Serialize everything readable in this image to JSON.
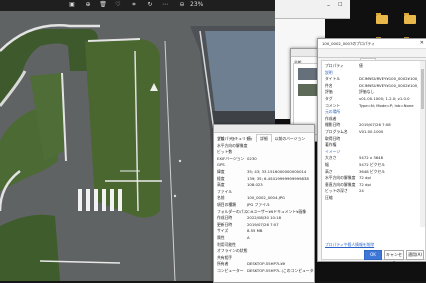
{
  "viewer": {
    "zoom": "23%",
    "toolbar_icons": [
      "image-icon",
      "zoom-in-icon",
      "delete-icon",
      "heart-icon",
      "crop-icon",
      "rotate-icon",
      "more-icon"
    ]
  },
  "desktop": {
    "folders": [
      "folder-icon",
      "folder-icon",
      "folder-icon",
      "folder-icon"
    ]
  },
  "win_back": {
    "title": "",
    "tabs": [
      "全般",
      "セキュリティ",
      "詳細",
      "以前のバージョン"
    ],
    "rows": [
      {
        "label": "プロパティ",
        "value": "値"
      },
      {
        "label": "水平方向の解像度",
        "value": ""
      },
      {
        "label": "ビット数",
        "value": ""
      },
      {
        "label": "EXIFバージョン",
        "value": "0230"
      },
      {
        "label": "GPS",
        "value": ""
      },
      {
        "label": "緯度",
        "value": "35; 43; 33.1516000000000014"
      },
      {
        "label": "経度",
        "value": "139; 35; 6.45419999999999838"
      },
      {
        "label": "高度",
        "value": "108.023"
      },
      {
        "label": "ファイル",
        "value": ""
      },
      {
        "label": "名前",
        "value": "100_0002_0004.JPG"
      },
      {
        "label": "項目の種類",
        "value": "JPG ファイル"
      },
      {
        "label": "フォルダーのパス",
        "value": "C:¥ユーザー¥¥ドキュメント¥画像"
      },
      {
        "label": "作成日時",
        "value": "2022/08/30 10:18"
      },
      {
        "label": "更新日時",
        "value": "2019/07/26 7:07"
      },
      {
        "label": "サイズ",
        "value": "8.55 MB"
      },
      {
        "label": "属性",
        "value": "A"
      },
      {
        "label": "利用可能性",
        "value": ""
      },
      {
        "label": "オフラインの状態",
        "value": ""
      },
      {
        "label": "共有相手",
        "value": ""
      },
      {
        "label": "所有者",
        "value": "DESKTOP-55HP7L¥¥"
      },
      {
        "label": "コンピューター",
        "value": "DESKTOP-55HP7L (このコンピューター)"
      }
    ]
  },
  "win_front": {
    "title": "100_0002_0007のプロパティ",
    "close_label": "✕",
    "tabs": [
      "全般",
      "セキュリティ",
      "詳細",
      "以前のバージョン"
    ],
    "rows": [
      {
        "label": "プロパティ",
        "value": "値",
        "section": false
      },
      {
        "label": "説明",
        "value": "",
        "section": true
      },
      {
        "label": "タイトル",
        "value": "DCIM¥SURVEY¥100_0002¥100_0002_0007",
        "section": false
      },
      {
        "label": "件名",
        "value": "DCIM¥SURVEY¥100_0002¥100_0002_0007",
        "section": false
      },
      {
        "label": "評価",
        "value": "評価なし",
        "section": false
      },
      {
        "label": "タグ",
        "value": "v01.00.1000; 1.2.0; v1.0.0",
        "section": false
      },
      {
        "label": "コメント",
        "value": "Type=N; Mode=P; Inb=None",
        "section": false
      },
      {
        "label": "元の場所",
        "value": "",
        "section": true
      },
      {
        "label": "作成者",
        "value": "",
        "section": false
      },
      {
        "label": "撮影日時",
        "value": "2019/07/26 7:08",
        "section": false
      },
      {
        "label": "プログラム名",
        "value": "V01.00.1000",
        "section": false
      },
      {
        "label": "取得日時",
        "value": "",
        "section": false
      },
      {
        "label": "著作権",
        "value": "",
        "section": false
      },
      {
        "label": "イメージ",
        "value": "",
        "section": true
      },
      {
        "label": "大きさ",
        "value": "5472 x 3648",
        "section": false
      },
      {
        "label": "幅",
        "value": "5472 ピクセル",
        "section": false
      },
      {
        "label": "高さ",
        "value": "3648 ピクセル",
        "section": false
      },
      {
        "label": "水平方向の解像度",
        "value": "72 dpi",
        "section": false
      },
      {
        "label": "垂直方向の解像度",
        "value": "72 dpi",
        "section": false
      },
      {
        "label": "ビットの深さ",
        "value": "24",
        "section": false
      },
      {
        "label": "圧縮",
        "value": "",
        "section": false
      }
    ],
    "link_label": "プロパティや個人情報を削除",
    "ok_label": "OK",
    "cancel_label": "キャンセル",
    "apply_label": "適用(A)"
  },
  "win_mid": {
    "tabs": [
      "全般",
      "セキュリティ",
      "詳細"
    ],
    "rows": [
      {
        "label": "プロパティ",
        "value": "値"
      },
      {
        "label": "説明",
        "value": ""
      },
      {
        "label": "タイトル",
        "value": "DCIM¥SURVEY¥100_0002"
      },
      {
        "label": "件名",
        "value": "DCIM¥SURVEY¥100_0002"
      },
      {
        "label": "評価",
        "value": "評価なし"
      },
      {
        "label": "タグ",
        "value": "v01.00.1000; 1.2.0"
      },
      {
        "label": "コメント",
        "value": ""
      },
      {
        "label": "作成日時",
        "value": "2019/07/26 7:07"
      }
    ]
  }
}
